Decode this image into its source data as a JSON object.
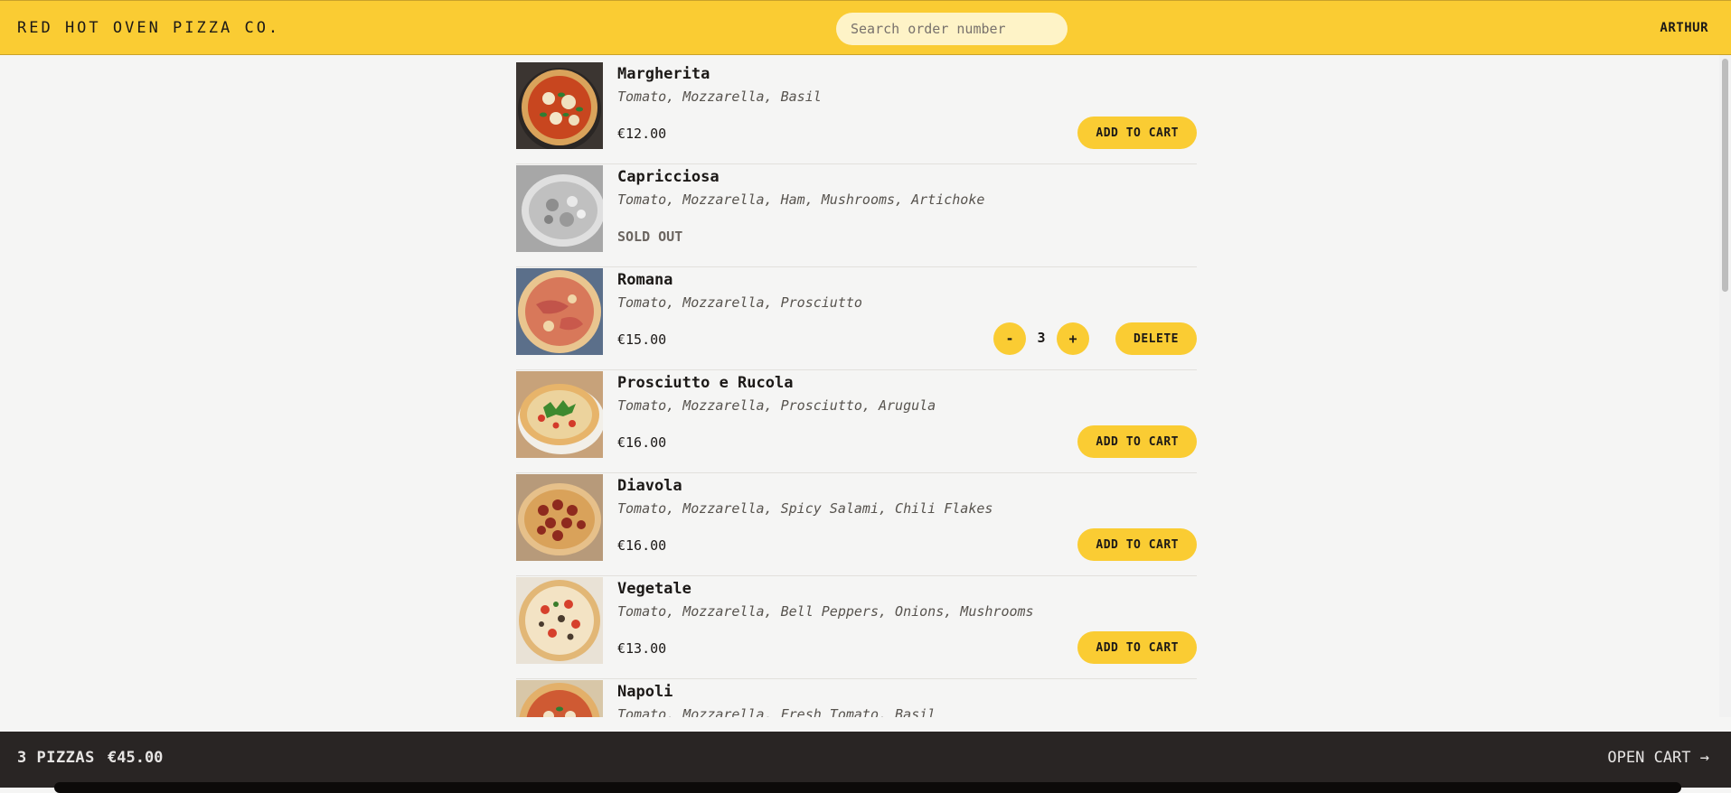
{
  "header": {
    "logo": "RED HOT OVEN PIZZA CO.",
    "search_placeholder": "Search order number",
    "username": "ARTHUR"
  },
  "menu": {
    "items": [
      {
        "name": "Margherita",
        "ingredients": "Tomato, Mozzarella, Basil",
        "price": "€12.00",
        "action": "ADD TO CART"
      },
      {
        "name": "Capricciosa",
        "ingredients": "Tomato, Mozzarella, Ham, Mushrooms, Artichoke",
        "status": "SOLD OUT"
      },
      {
        "name": "Romana",
        "ingredients": "Tomato, Mozzarella, Prosciutto",
        "price": "€15.00",
        "quantity": "3",
        "decrease": "-",
        "increase": "+",
        "delete": "DELETE"
      },
      {
        "name": "Prosciutto e Rucola",
        "ingredients": "Tomato, Mozzarella, Prosciutto, Arugula",
        "price": "€16.00",
        "action": "ADD TO CART"
      },
      {
        "name": "Diavola",
        "ingredients": "Tomato, Mozzarella, Spicy Salami, Chili Flakes",
        "price": "€16.00",
        "action": "ADD TO CART"
      },
      {
        "name": "Vegetale",
        "ingredients": "Tomato, Mozzarella, Bell Peppers, Onions, Mushrooms",
        "price": "€13.00",
        "action": "ADD TO CART"
      },
      {
        "name": "Napoli",
        "ingredients": "Tomato, Mozzarella, Fresh Tomato, Basil"
      }
    ]
  },
  "cart": {
    "count": "3 PIZZAS",
    "total": "€45.00",
    "open": "OPEN CART →"
  },
  "colors": {
    "accent": "#facc33",
    "background": "#f5f5f4",
    "cartbar": "#292524"
  }
}
